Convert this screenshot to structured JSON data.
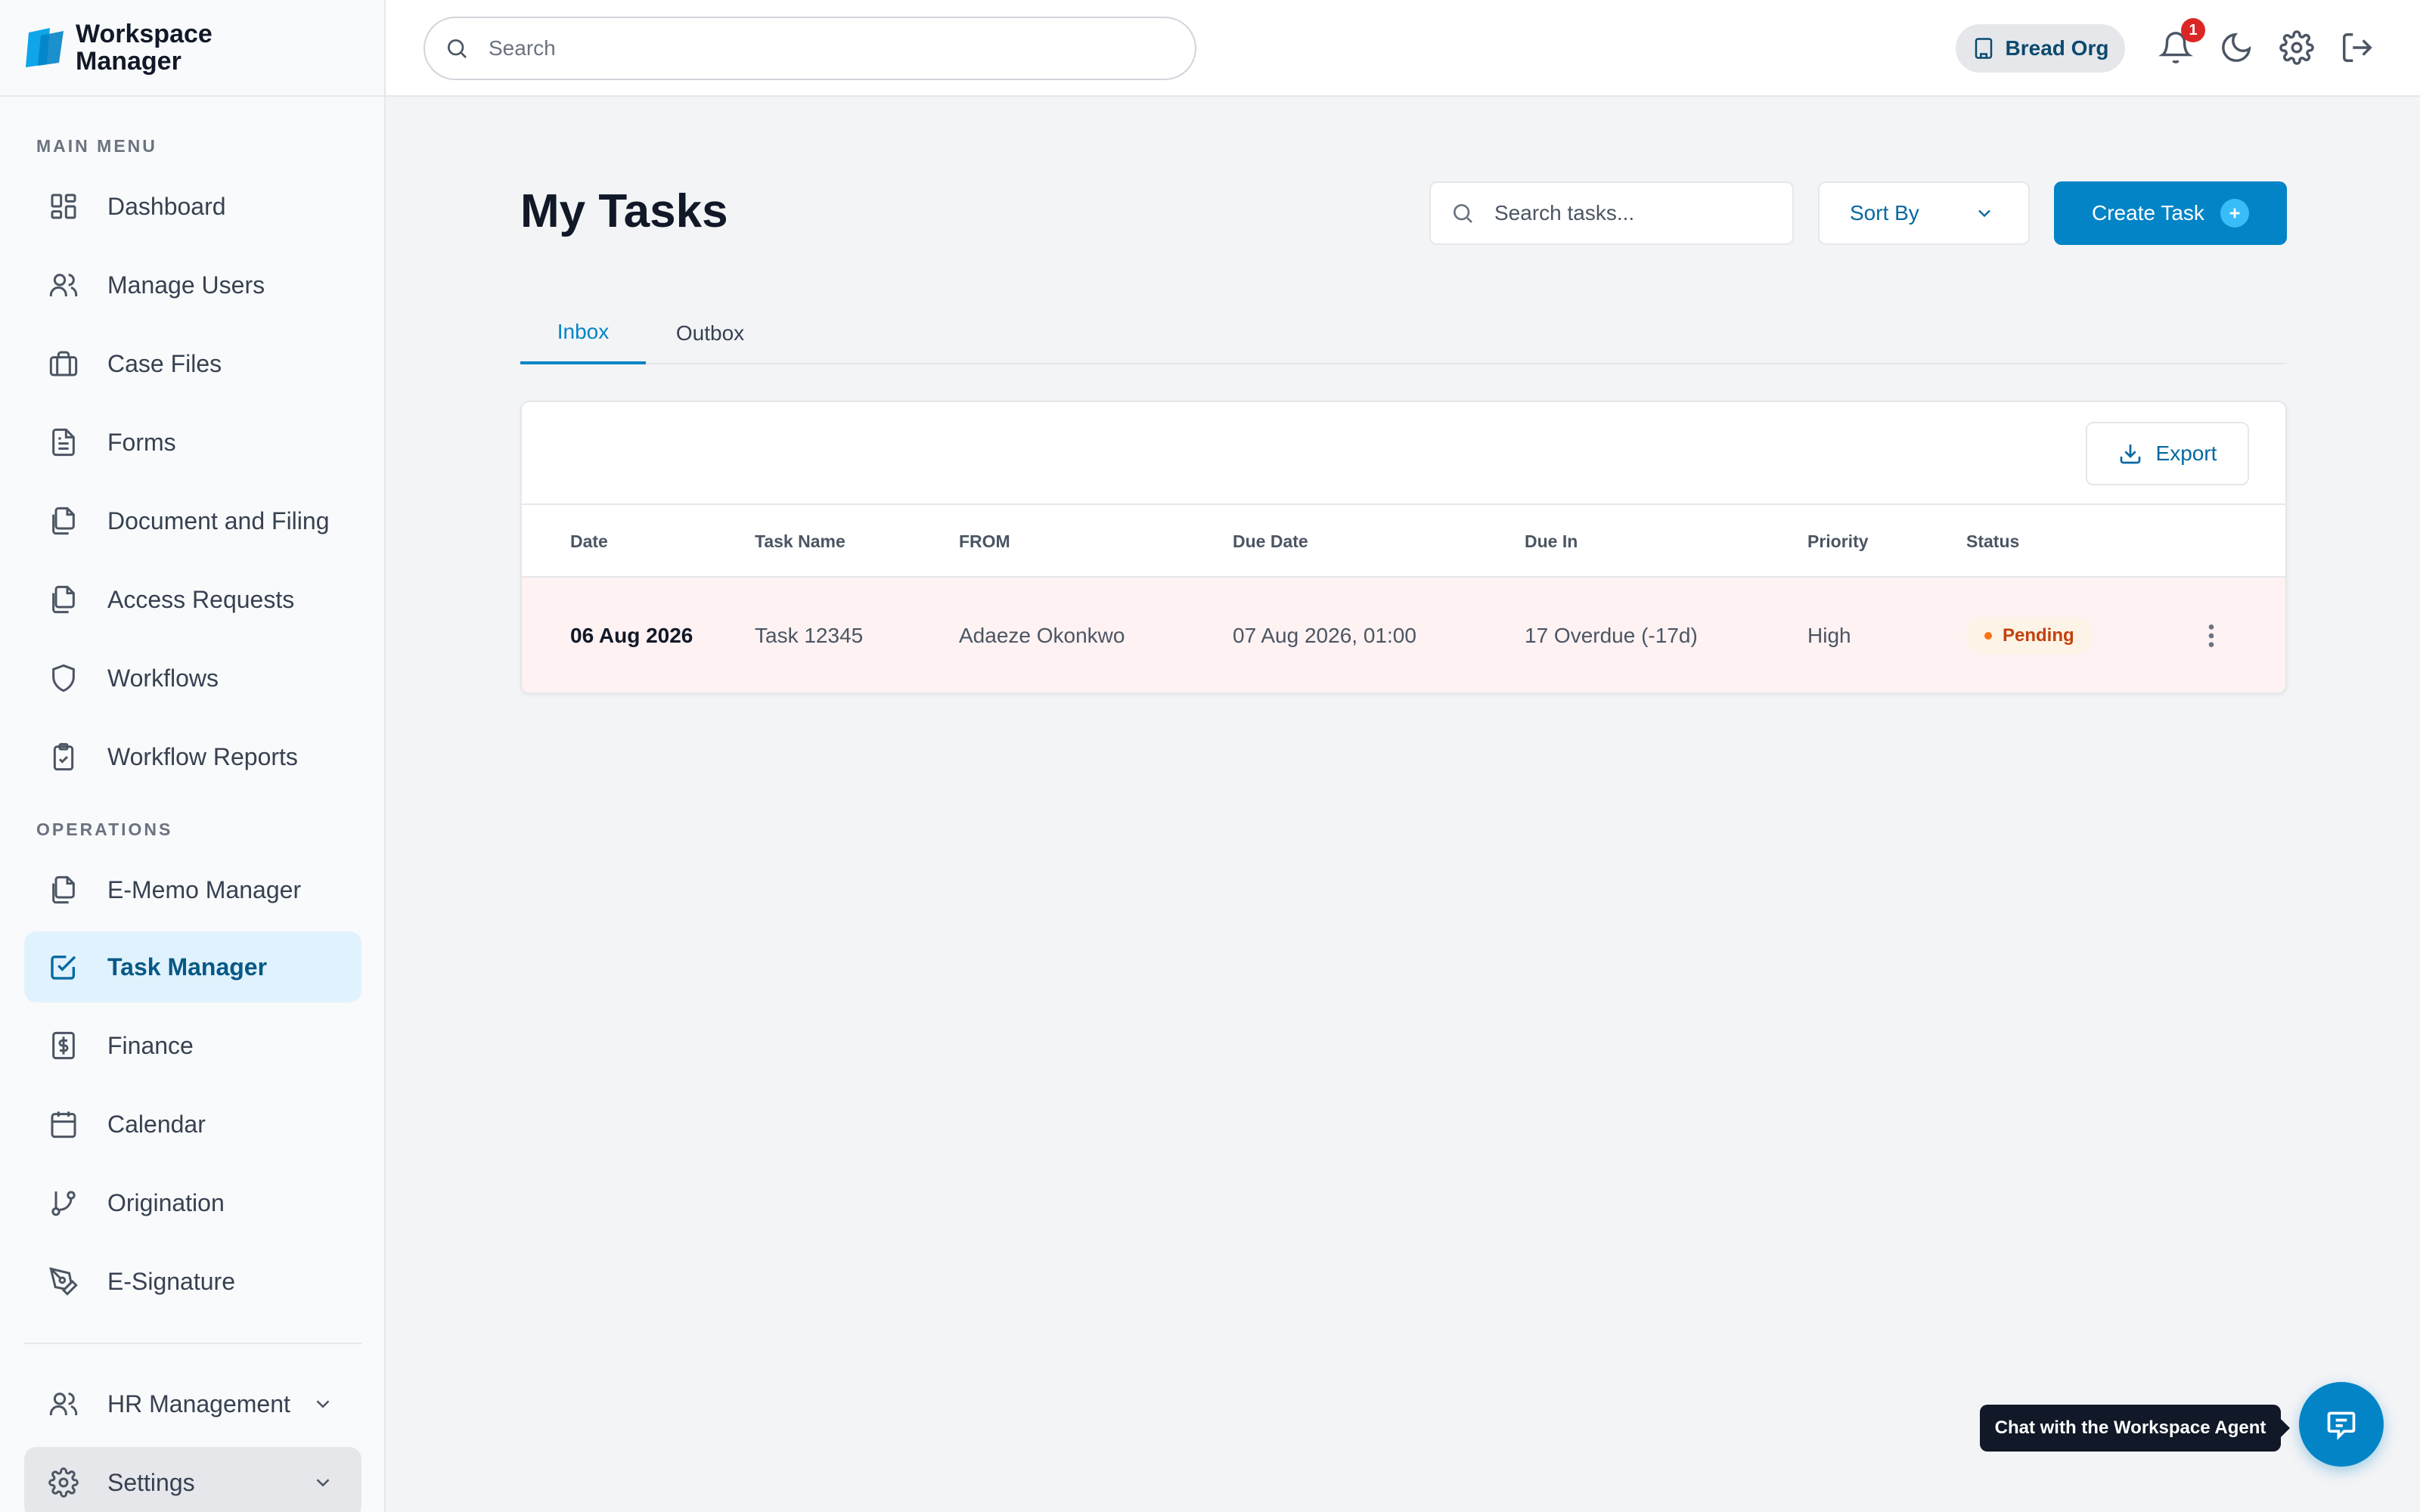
{
  "brand": {
    "name": "Workspace Manager"
  },
  "topbar": {
    "search_placeholder": "Search",
    "org_name": "Bread Org",
    "notification_count": "1"
  },
  "sidebar": {
    "main_menu_label": "MAIN MENU",
    "operations_label": "OPERATIONS",
    "main_items": [
      {
        "label": "Dashboard",
        "icon": "dashboard-icon"
      },
      {
        "label": "Manage Users",
        "icon": "users-icon"
      },
      {
        "label": "Case Files",
        "icon": "briefcase-icon"
      },
      {
        "label": "Forms",
        "icon": "form-icon"
      },
      {
        "label": "Document and Filing",
        "icon": "documents-icon"
      },
      {
        "label": "Access Requests",
        "icon": "documents-icon"
      },
      {
        "label": "Workflows",
        "icon": "shield-icon"
      },
      {
        "label": "Workflow Reports",
        "icon": "clipboard-check-icon"
      }
    ],
    "operations_items": [
      {
        "label": "E-Memo Manager",
        "icon": "documents-icon"
      },
      {
        "label": "Task Manager",
        "icon": "checkbox-icon",
        "active": true
      },
      {
        "label": "Finance",
        "icon": "dollar-icon"
      },
      {
        "label": "Calendar",
        "icon": "calendar-icon"
      },
      {
        "label": "Origination",
        "icon": "git-branch-icon"
      },
      {
        "label": "E-Signature",
        "icon": "pen-icon"
      }
    ],
    "bottom_items": [
      {
        "label": "HR Management",
        "icon": "users-icon"
      },
      {
        "label": "Settings",
        "icon": "gear-icon"
      }
    ]
  },
  "main": {
    "title": "My Tasks",
    "search_placeholder": "Search tasks...",
    "sort_label": "Sort By",
    "create_label": "Create Task",
    "tabs": [
      {
        "label": "Inbox",
        "active": true
      },
      {
        "label": "Outbox",
        "active": false
      }
    ],
    "export_label": "Export",
    "table": {
      "columns": [
        "Date",
        "Task Name",
        "FROM",
        "Due Date",
        "Due In",
        "Priority",
        "Status"
      ],
      "rows": [
        {
          "date": "06 Aug 2026",
          "task_name": "Task 12345",
          "from": "Adaeze Okonkwo",
          "due_date": "07 Aug 2026, 01:00",
          "due_in": "17 Overdue (-17d)",
          "priority": "High",
          "status": "Pending"
        }
      ]
    }
  },
  "chat": {
    "tooltip": "Chat with the Workspace Agent"
  },
  "colors": {
    "accent": "#0284c7",
    "active_nav_bg": "#e0f2fe",
    "overdue_row_bg": "#fef2f2",
    "status_pending": "#f97316",
    "notification_badge": "#dc2626"
  }
}
